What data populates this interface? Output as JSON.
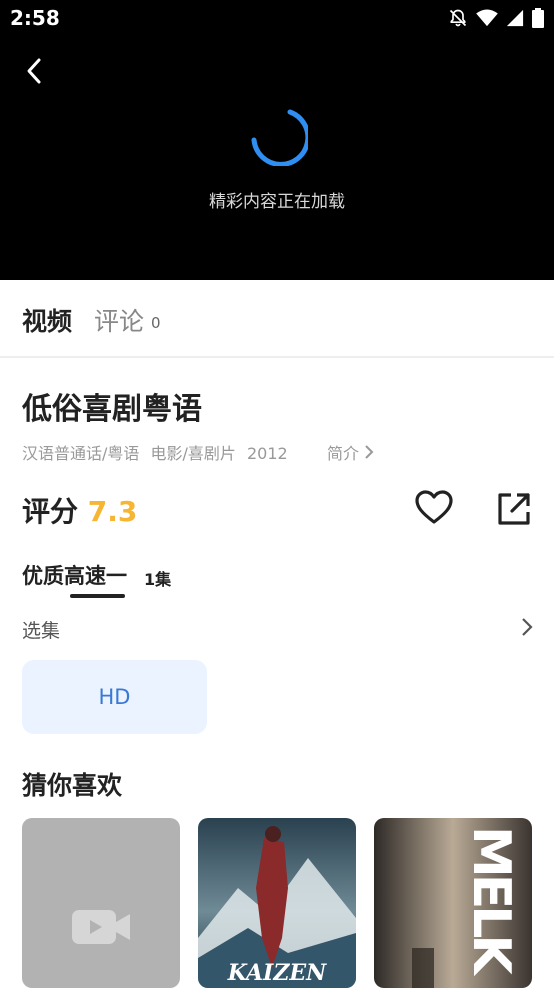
{
  "status_bar": {
    "time": "2:58",
    "icons": [
      "bell-off-icon",
      "wifi-icon",
      "cellular-signal-icon",
      "battery-icon"
    ]
  },
  "player": {
    "loading_text": "精彩内容正在加载",
    "spinner_color": "#2f8ef0"
  },
  "tabs": {
    "video": "视频",
    "comment": "评论",
    "comment_count": "0"
  },
  "detail": {
    "title": "低俗喜剧粤语",
    "meta": [
      "汉语普通话/粤语",
      "电影/喜剧片",
      "2012"
    ],
    "intro_label": "简介",
    "rating_label": "评分",
    "rating_value": "7.3"
  },
  "source": {
    "name": "优质高速一",
    "episode_count": "1集"
  },
  "episodes": {
    "label": "选集",
    "items": [
      {
        "label": "HD"
      }
    ]
  },
  "recommendations": {
    "title": "猜你喜欢",
    "items": [
      {
        "poster_text": ""
      },
      {
        "poster_text": "KAIZEN"
      },
      {
        "poster_text": "MELK"
      }
    ]
  },
  "colors": {
    "accent": "#f6b532",
    "episode_card_bg": "#eaf3ff",
    "episode_card_text": "#3a78d6"
  }
}
